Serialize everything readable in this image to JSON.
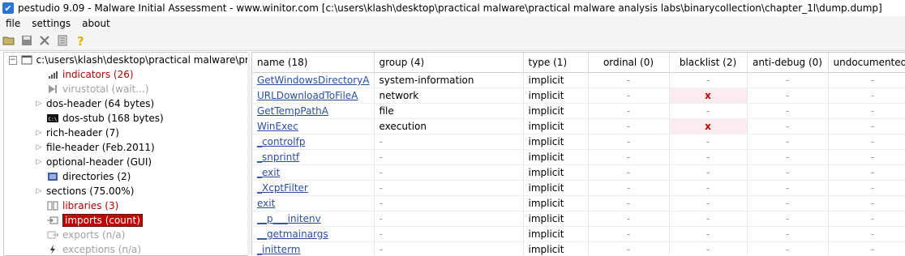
{
  "window": {
    "title": "pestudio 9.09 - Malware Initial Assessment - www.winitor.com [c:\\users\\klash\\desktop\\practical malware\\practical malware analysis labs\\binarycollection\\chapter_1l\\dump.dump]"
  },
  "menu": {
    "items": [
      {
        "label": "file"
      },
      {
        "label": "settings"
      },
      {
        "label": "about"
      }
    ]
  },
  "toolbar": {
    "buttons": [
      "open-folder-icon",
      "save-icon",
      "close-icon",
      "document-icon",
      "help-icon"
    ]
  },
  "tree": {
    "root_label": "c:\\users\\klash\\desktop\\practical malware\\practical malware",
    "items": [
      {
        "label": "indicators (26)",
        "style": "red",
        "icon": "bar-chart-icon"
      },
      {
        "label": "virustotal (wait...)",
        "style": "gray",
        "icon": "virustotal-icon"
      },
      {
        "label": "dos-header (64 bytes)",
        "style": "normal",
        "icon": "none"
      },
      {
        "label": "dos-stub (168 bytes)",
        "style": "normal",
        "icon": "console-icon"
      },
      {
        "label": "rich-header (7)",
        "style": "normal",
        "icon": "none"
      },
      {
        "label": "file-header (Feb.2011)",
        "style": "normal",
        "icon": "none"
      },
      {
        "label": "optional-header (GUI)",
        "style": "normal",
        "icon": "none"
      },
      {
        "label": "directories (2)",
        "style": "normal",
        "icon": "directories-icon"
      },
      {
        "label": "sections (75.00%)",
        "style": "normal",
        "icon": "none"
      },
      {
        "label": "libraries (3)",
        "style": "red",
        "icon": "libraries-icon"
      },
      {
        "label": "imports (count)",
        "style": "selected",
        "icon": "imports-icon"
      },
      {
        "label": "exports (n/a)",
        "style": "gray",
        "icon": "exports-icon"
      },
      {
        "label": "exceptions (n/a)",
        "style": "gray",
        "icon": "exceptions-icon"
      }
    ]
  },
  "table": {
    "columns": [
      "name (18)",
      "group (4)",
      "type (1)",
      "ordinal (0)",
      "blacklist (2)",
      "anti-debug (0)",
      "undocumented"
    ],
    "rows": [
      {
        "name": "GetWindowsDirectoryA",
        "group": "system-information",
        "type": "implicit",
        "ordinal": "-",
        "blacklist": "-",
        "antidebug": "-",
        "undocumented": "-"
      },
      {
        "name": "URLDownloadToFileA",
        "group": "network",
        "type": "implicit",
        "ordinal": "-",
        "blacklist": "x",
        "antidebug": "-",
        "undocumented": "-"
      },
      {
        "name": "GetTempPathA",
        "group": "file",
        "type": "implicit",
        "ordinal": "-",
        "blacklist": "-",
        "antidebug": "-",
        "undocumented": "-"
      },
      {
        "name": "WinExec",
        "group": "execution",
        "type": "implicit",
        "ordinal": "-",
        "blacklist": "x",
        "antidebug": "-",
        "undocumented": "-"
      },
      {
        "name": "_controlfp",
        "group": "-",
        "type": "implicit",
        "ordinal": "-",
        "blacklist": "-",
        "antidebug": "-",
        "undocumented": "-"
      },
      {
        "name": "_snprintf",
        "group": "-",
        "type": "implicit",
        "ordinal": "-",
        "blacklist": "-",
        "antidebug": "-",
        "undocumented": "-"
      },
      {
        "name": "_exit",
        "group": "-",
        "type": "implicit",
        "ordinal": "-",
        "blacklist": "-",
        "antidebug": "-",
        "undocumented": "-"
      },
      {
        "name": "_XcptFilter",
        "group": "-",
        "type": "implicit",
        "ordinal": "-",
        "blacklist": "-",
        "antidebug": "-",
        "undocumented": "-"
      },
      {
        "name": "exit",
        "group": "-",
        "type": "implicit",
        "ordinal": "-",
        "blacklist": "-",
        "antidebug": "-",
        "undocumented": "-"
      },
      {
        "name": "__p___initenv",
        "group": "-",
        "type": "implicit",
        "ordinal": "-",
        "blacklist": "-",
        "antidebug": "-",
        "undocumented": "-"
      },
      {
        "name": "__getmainargs",
        "group": "-",
        "type": "implicit",
        "ordinal": "-",
        "blacklist": "-",
        "antidebug": "-",
        "undocumented": "-"
      },
      {
        "name": "_initterm",
        "group": "-",
        "type": "implicit",
        "ordinal": "-",
        "blacklist": "-",
        "antidebug": "-",
        "undocumented": "-"
      }
    ]
  },
  "colors": {
    "accent_red": "#b40000",
    "selection": "#c00000",
    "link": "#2a4fa0",
    "blacklist_bg": "#fcecef"
  }
}
